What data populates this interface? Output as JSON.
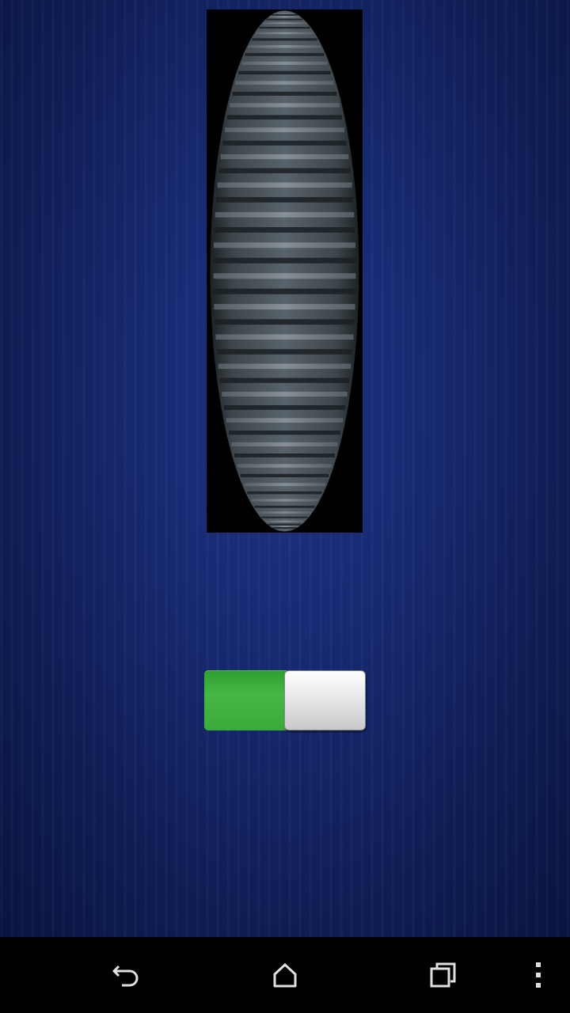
{
  "screen": {
    "background_color": "#172a72",
    "navbar_color": "#000000"
  },
  "wheel": {
    "description_icon": "ridged-scroll-wheel",
    "background_color": "#000000",
    "rib_color": "#4a5358"
  },
  "toggle": {
    "state": "on",
    "on_color": "#3fb23f",
    "knob_color": "#e6e6e6"
  },
  "navbar": {
    "buttons": [
      {
        "icon": "back-icon"
      },
      {
        "icon": "home-icon"
      },
      {
        "icon": "recents-icon"
      },
      {
        "icon": "overflow-menu-icon"
      }
    ]
  }
}
